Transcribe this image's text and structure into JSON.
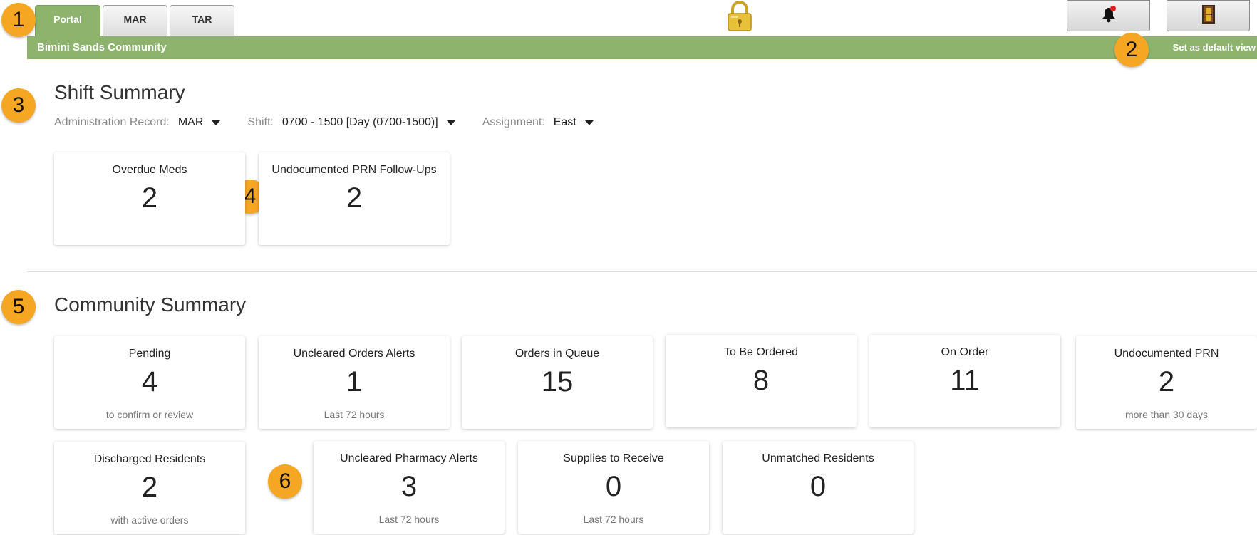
{
  "tabs": [
    {
      "label": "Portal",
      "active": true
    },
    {
      "label": "MAR",
      "active": false
    },
    {
      "label": "TAR",
      "active": false
    }
  ],
  "header": {
    "community_name": "Bimini Sands Community",
    "default_view_link": "Set as default view"
  },
  "icons": {
    "lock": "lock-icon",
    "notifications": "bell-icon",
    "logout": "exit-door-icon"
  },
  "colors": {
    "accent_green": "#8db36d",
    "callout_orange": "#f5a623",
    "notification_dot": "#e02020"
  },
  "callouts": [
    "1",
    "2",
    "3",
    "4",
    "5",
    "6"
  ],
  "shift_summary": {
    "title": "Shift Summary",
    "filters": {
      "administration_record": {
        "label": "Administration Record:",
        "value": "MAR"
      },
      "shift": {
        "label": "Shift:",
        "value": "0700 - 1500 [Day (0700-1500)]"
      },
      "assignment": {
        "label": "Assignment:",
        "value": "East"
      }
    },
    "cards": [
      {
        "label": "Overdue Meds",
        "value": "2"
      },
      {
        "label": "Undocumented PRN Follow-Ups",
        "value": "2"
      }
    ]
  },
  "community_summary": {
    "title": "Community Summary",
    "cards": [
      {
        "label": "Pending",
        "value": "4",
        "sub": "to confirm or review"
      },
      {
        "label": "Uncleared Orders Alerts",
        "value": "1",
        "sub": "Last 72 hours"
      },
      {
        "label": "Orders in Queue",
        "value": "15",
        "sub": ""
      },
      {
        "label": "To Be Ordered",
        "value": "8",
        "sub": ""
      },
      {
        "label": "On Order",
        "value": "11",
        "sub": ""
      },
      {
        "label": "Undocumented PRN",
        "value": "2",
        "sub": "more than 30 days"
      },
      {
        "label": "Discharged Residents",
        "value": "2",
        "sub": "with active orders"
      },
      {
        "label": "Uncleared Pharmacy Alerts",
        "value": "3",
        "sub": "Last 72 hours"
      },
      {
        "label": "Supplies to Receive",
        "value": "0",
        "sub": "Last 72 hours"
      },
      {
        "label": "Unmatched Residents",
        "value": "0",
        "sub": ""
      }
    ]
  }
}
